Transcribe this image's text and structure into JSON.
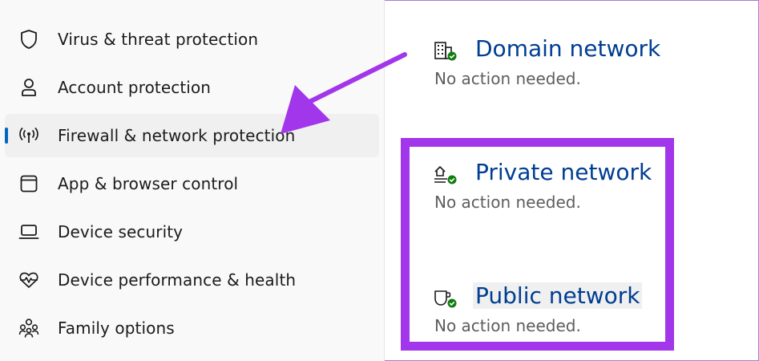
{
  "sidebar": {
    "items": [
      {
        "label": "Virus & threat protection",
        "icon": "shield-icon",
        "selected": false
      },
      {
        "label": "Account protection",
        "icon": "person-icon",
        "selected": false
      },
      {
        "label": "Firewall & network protection",
        "icon": "wireless-antenna-icon",
        "selected": true
      },
      {
        "label": "App & browser control",
        "icon": "app-window-icon",
        "selected": false
      },
      {
        "label": "Device security",
        "icon": "laptop-icon",
        "selected": false
      },
      {
        "label": "Device performance & health",
        "icon": "heart-pulse-icon",
        "selected": false
      },
      {
        "label": "Family options",
        "icon": "family-icon",
        "selected": false
      }
    ]
  },
  "networks": [
    {
      "title": "Domain network",
      "status": "No action needed.",
      "icon": "domain-building-icon"
    },
    {
      "title": "Private network",
      "status": "No action needed.",
      "icon": "private-home-network-icon"
    },
    {
      "title": "Public network",
      "status": "No action needed.",
      "icon": "public-coffee-network-icon"
    }
  ],
  "colors": {
    "accent": "#0067c0",
    "link": "#003e92",
    "annotation": "#a236ea",
    "check_badge": "#107c10"
  }
}
